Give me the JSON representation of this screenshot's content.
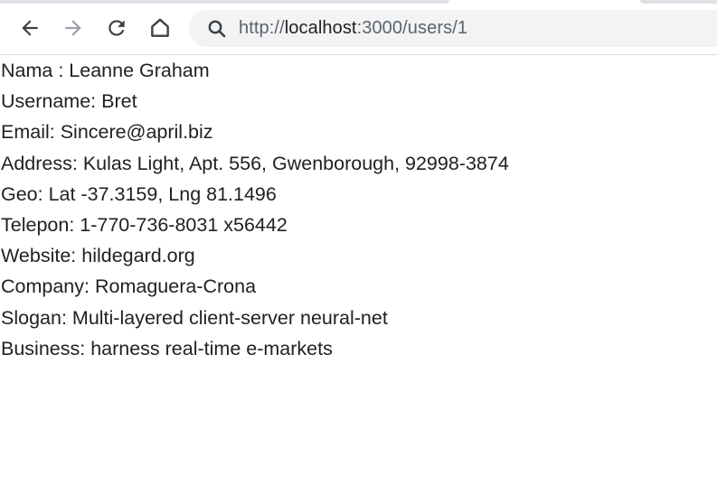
{
  "browser": {
    "url_scheme": "http://",
    "url_host": "localhost",
    "url_path": ":3000/users/1",
    "icons": {
      "back": "arrow-left-icon",
      "forward": "arrow-right-icon",
      "reload": "reload-icon",
      "home": "home-icon",
      "search": "search-icon"
    }
  },
  "user": {
    "name_label": "Nama : ",
    "name": "Leanne Graham",
    "username_label": "Username: ",
    "username": "Bret",
    "email_label": "Email: ",
    "email": "Sincere@april.biz",
    "address_label": "Address: ",
    "address": "Kulas Light, Apt. 556, Gwenborough, 92998-3874",
    "geo_label": "Geo: ",
    "geo": "Lat -37.3159, Lng 81.1496",
    "phone_label": "Telepon: ",
    "phone": "1-770-736-8031 x56442",
    "website_label": "Website: ",
    "website": "hildegard.org",
    "company_label": "Company: ",
    "company": "Romaguera-Crona",
    "slogan_label": "Slogan: ",
    "slogan": "Multi-layered client-server neural-net",
    "business_label": "Business: ",
    "business": "harness real-time e-markets"
  }
}
